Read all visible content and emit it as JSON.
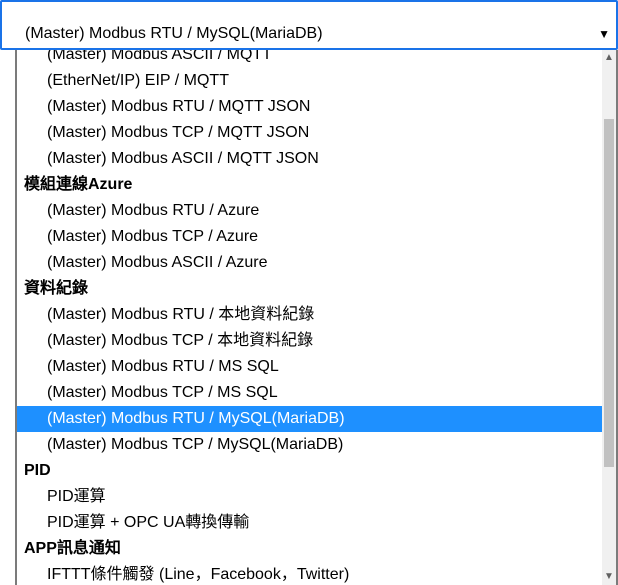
{
  "select": {
    "value": "(Master) Modbus RTU / MySQL(MariaDB)",
    "arrow_icon": "▼"
  },
  "dropdown": {
    "scroll_up_icon": "▲",
    "scroll_down_icon": "▼",
    "scroll_fraction": 0.34,
    "rows": [
      {
        "type": "option",
        "label": "(Master) Modbus ASCII / MQTT"
      },
      {
        "type": "option",
        "label": "(EtherNet/IP) EIP / MQTT"
      },
      {
        "type": "option",
        "label": "(Master) Modbus RTU / MQTT JSON"
      },
      {
        "type": "option",
        "label": "(Master) Modbus TCP / MQTT JSON"
      },
      {
        "type": "option",
        "label": "(Master) Modbus ASCII / MQTT JSON"
      },
      {
        "type": "group",
        "label": "模組連線Azure"
      },
      {
        "type": "option",
        "label": "(Master) Modbus RTU / Azure"
      },
      {
        "type": "option",
        "label": "(Master) Modbus TCP / Azure"
      },
      {
        "type": "option",
        "label": "(Master) Modbus ASCII / Azure"
      },
      {
        "type": "group",
        "label": "資料紀錄"
      },
      {
        "type": "option",
        "label": "(Master) Modbus RTU / 本地資料紀錄"
      },
      {
        "type": "option",
        "label": "(Master) Modbus TCP / 本地資料紀錄"
      },
      {
        "type": "option",
        "label": "(Master) Modbus RTU / MS SQL"
      },
      {
        "type": "option",
        "label": "(Master) Modbus TCP / MS SQL"
      },
      {
        "type": "option",
        "label": "(Master) Modbus RTU / MySQL(MariaDB)",
        "selected": true
      },
      {
        "type": "option",
        "label": "(Master) Modbus TCP / MySQL(MariaDB)"
      },
      {
        "type": "group",
        "label": "PID"
      },
      {
        "type": "option",
        "label": "PID運算"
      },
      {
        "type": "option",
        "label": "PID運算 + OPC UA轉換傳輸"
      },
      {
        "type": "group",
        "label": "APP訊息通知"
      },
      {
        "type": "option",
        "label": "IFTTT條件觸發 (Line，Facebook，Twitter)"
      }
    ]
  }
}
